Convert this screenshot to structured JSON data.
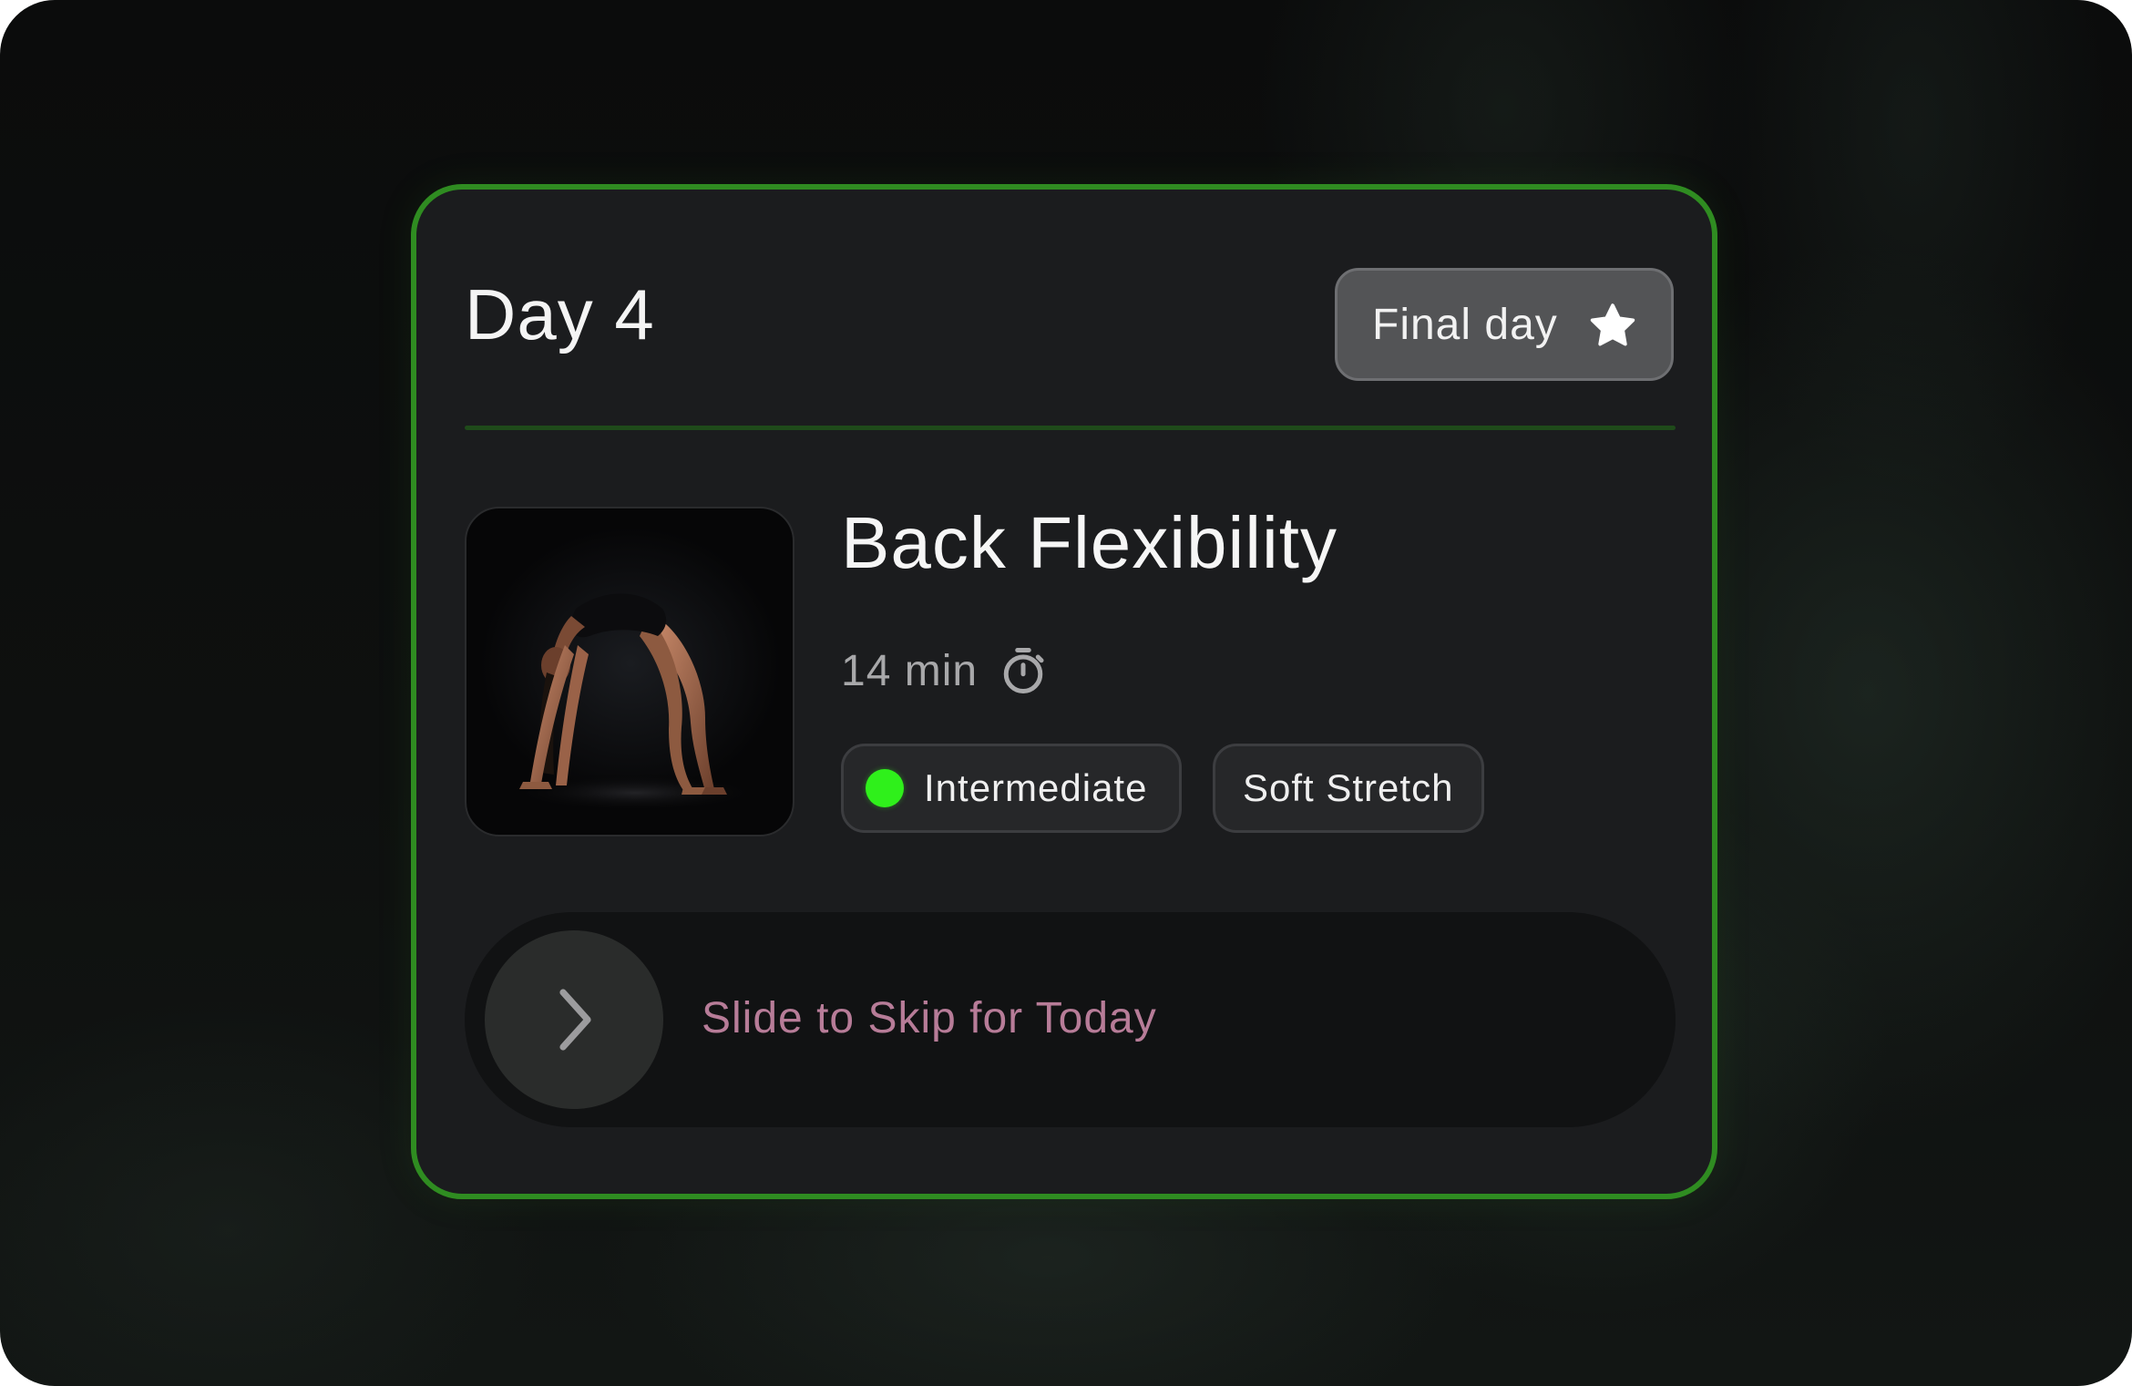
{
  "card": {
    "day_title": "Day 4",
    "badge": {
      "label": "Final day",
      "icon": "star-icon"
    },
    "workout": {
      "title": "Back Flexibility",
      "duration": "14 min",
      "duration_icon": "stopwatch-icon",
      "image": "backbend-pose-photo",
      "tags": {
        "level": {
          "label": "Intermediate",
          "dot_color": "#2ff01b"
        },
        "style": {
          "label": "Soft Stretch"
        }
      }
    },
    "slider": {
      "hint": "Slide to Skip for Today",
      "icon": "chevron-right-icon"
    }
  },
  "colors": {
    "accent_border": "#2f8c21",
    "card_background": "#1b1c1e",
    "hint_text": "#b77c98",
    "level_dot": "#2ff01b"
  }
}
